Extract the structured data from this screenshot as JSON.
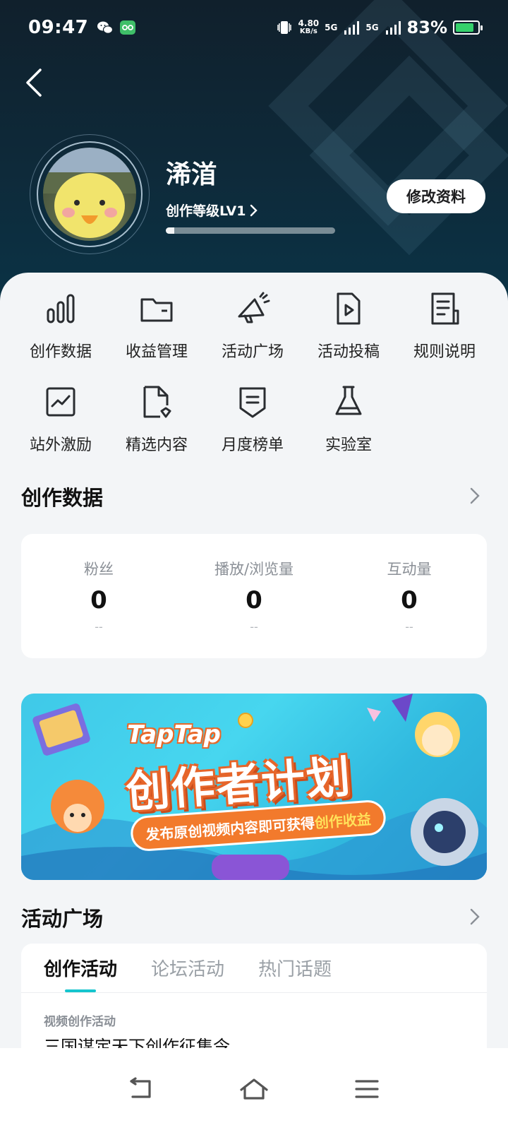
{
  "status_bar": {
    "time": "09:47",
    "net_speed_value": "4.80",
    "net_speed_unit": "KB/s",
    "sim1": "5G",
    "sim2": "5G",
    "battery_pct": "83%",
    "battery_level": 0.83
  },
  "profile": {
    "name": "浠渞",
    "level_label": "创作等级LV1",
    "level_progress": 0.05,
    "edit_button": "修改资料"
  },
  "grid": [
    {
      "label": "创作数据",
      "icon": "bar-chart-icon"
    },
    {
      "label": "收益管理",
      "icon": "wallet-icon"
    },
    {
      "label": "活动广场",
      "icon": "megaphone-icon"
    },
    {
      "label": "活动投稿",
      "icon": "video-file-icon"
    },
    {
      "label": "规则说明",
      "icon": "document-icon"
    },
    {
      "label": "站外激励",
      "icon": "trend-chart-icon"
    },
    {
      "label": "精选内容",
      "icon": "file-badge-icon"
    },
    {
      "label": "月度榜单",
      "icon": "ranking-icon"
    },
    {
      "label": "实验室",
      "icon": "flask-icon"
    }
  ],
  "creation_data": {
    "title": "创作数据",
    "stats": [
      {
        "label": "粉丝",
        "value": "0",
        "sub": "--"
      },
      {
        "label": "播放/浏览量",
        "value": "0",
        "sub": "--"
      },
      {
        "label": "互动量",
        "value": "0",
        "sub": "--"
      }
    ]
  },
  "banner": {
    "brand": "TapTap",
    "title": "创作者计划",
    "subtitle_main": "发布原创视频内容即可获得",
    "subtitle_highlight": "创作收益"
  },
  "activity_plaza": {
    "title": "活动广场",
    "tabs": [
      "创作活动",
      "论坛活动",
      "热门话题"
    ],
    "active_tab": 0,
    "item_tag": "视频创作活动",
    "item_title": "三国谋定天下创作征集令"
  },
  "colors": {
    "accent": "#15c5ce",
    "banner_orange": "#f27a2c",
    "header_bg": "#0e2a3a"
  }
}
